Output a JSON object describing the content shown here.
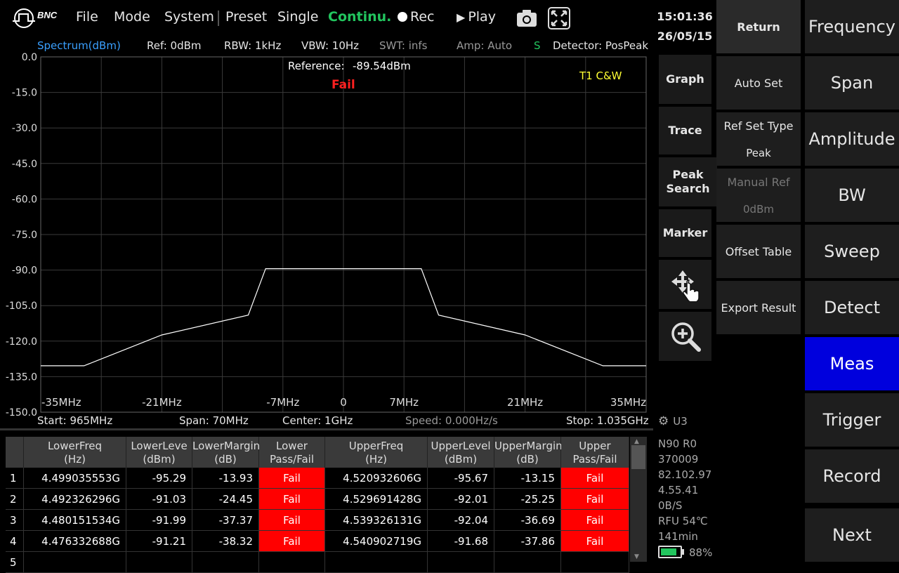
{
  "menu": {
    "brand": "BNC",
    "items": [
      "File",
      "Mode",
      "System",
      "Preset",
      "Single",
      "Continu.",
      "Rec",
      "Play"
    ]
  },
  "status": {
    "spectrum": "Spectrum(dBm)",
    "ref": "Ref: 0dBm",
    "rbw": "RBW: 1kHz",
    "vbw": "VBW: 10Hz",
    "swt": "SWT: infs",
    "amp": "Amp: Auto",
    "s": "S",
    "detector": "Detector: PosPeak"
  },
  "plot": {
    "reference_label": "Reference:",
    "reference_value": "-89.54dBm",
    "result": "Fail",
    "trace_label": "T1 C&W"
  },
  "chart_data": {
    "type": "line",
    "xlabel": "",
    "ylabel": "",
    "xlim": [
      -35,
      35
    ],
    "ylim": [
      -150,
      0
    ],
    "x_unit": "MHz",
    "y_ticks": [
      "0.0",
      "-15.0",
      "-30.0",
      "-45.0",
      "-60.0",
      "-75.0",
      "-90.0",
      "-105.0",
      "-120.0",
      "-135.0",
      "-150.0"
    ],
    "x_ticks": [
      {
        "v": -35,
        "label": "-35MHz"
      },
      {
        "v": -21,
        "label": "-21MHz"
      },
      {
        "v": -7,
        "label": "-7MHz"
      },
      {
        "v": 0,
        "label": "0"
      },
      {
        "v": 7,
        "label": "7MHz"
      },
      {
        "v": 21,
        "label": "21MHz"
      },
      {
        "v": 35,
        "label": "35MHz"
      }
    ],
    "x": [
      -35,
      -30,
      -21,
      -11,
      -9,
      9,
      11,
      21,
      30,
      35
    ],
    "y": [
      -130.4,
      -130.4,
      -117.4,
      -109.0,
      -89.4,
      -89.4,
      -109.0,
      -117.4,
      -130.4,
      -130.4
    ]
  },
  "freq_bar": {
    "start": "Start: 965MHz",
    "span": "Span: 70MHz",
    "center": "Center: 1GHz",
    "speed": "Speed: 0.000Hz/s",
    "stop": "Stop: 1.035GHz"
  },
  "table": {
    "headers": [
      {
        "l1": "LowerFreq",
        "l2": "(Hz)"
      },
      {
        "l1": "LowerLeve",
        "l2": "(dBm)"
      },
      {
        "l1": "LowerMargin",
        "l2": "(dB)"
      },
      {
        "l1": "Lower",
        "l2": "Pass/Fail"
      },
      {
        "l1": "UpperFreq",
        "l2": "(Hz)"
      },
      {
        "l1": "UpperLevel",
        "l2": "(dBm)"
      },
      {
        "l1": "UpperMargin",
        "l2": "(dB)"
      },
      {
        "l1": "Upper",
        "l2": "Pass/Fail"
      }
    ],
    "rows": [
      [
        "1",
        "4.499035553G",
        "-95.29",
        "-13.93",
        "Fail",
        "4.520932606G",
        "-95.67",
        "-13.15",
        "Fail"
      ],
      [
        "2",
        "4.492326296G",
        "-91.03",
        "-24.45",
        "Fail",
        "4.529691428G",
        "-92.01",
        "-25.25",
        "Fail"
      ],
      [
        "3",
        "4.480151534G",
        "-91.99",
        "-37.37",
        "Fail",
        "4.539326131G",
        "-92.04",
        "-36.69",
        "Fail"
      ],
      [
        "4",
        "4.476332688G",
        "-91.21",
        "-38.32",
        "Fail",
        "4.540902719G",
        "-91.68",
        "-37.86",
        "Fail"
      ],
      [
        "5",
        "",
        "",
        "",
        "",
        "",
        "",
        "",
        ""
      ]
    ]
  },
  "clock": {
    "time": "15:01:36",
    "date": "26/05/15"
  },
  "left_menu": [
    "Graph",
    "Trace",
    "Peak Search",
    "Marker"
  ],
  "soft_menu": {
    "return": "Return",
    "auto_set": "Auto Set",
    "ref_set_type": "Ref Set Type",
    "ref_set_type_value": "Peak",
    "manual_ref": "Manual Ref",
    "manual_ref_value": "0dBm",
    "offset_table": "Offset Table",
    "export_result": "Export Result"
  },
  "main_menu": [
    "Frequency",
    "Span",
    "Amplitude",
    "BW",
    "Sweep",
    "Detect",
    "Meas",
    "Trigger",
    "Record",
    "Next"
  ],
  "device_info": {
    "u3": "U3",
    "lines": [
      "N90 R0",
      "370009",
      "82.102.97",
      "4.55.41",
      "0B/S",
      "RFU  54℃",
      "141min"
    ],
    "battery": "88%"
  },
  "colors": {
    "accent": "#0000dd",
    "fail": "#ff0000",
    "continu": "#22c55e",
    "trace_label": "#ffff00"
  }
}
